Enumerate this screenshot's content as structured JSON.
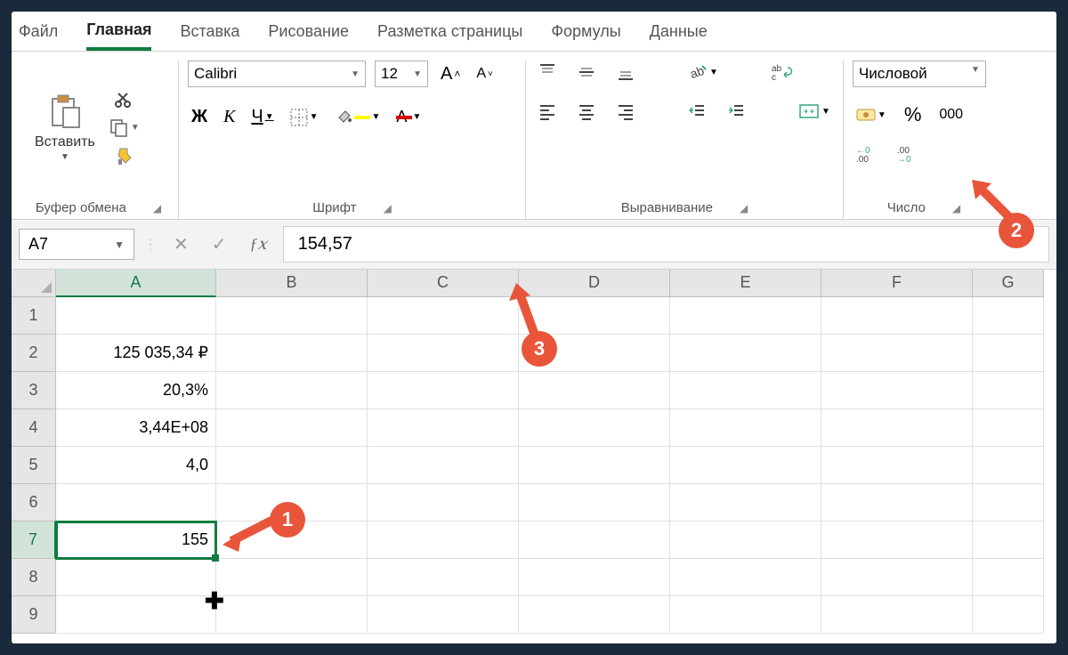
{
  "tabs": {
    "file": "Файл",
    "home": "Главная",
    "insert": "Вставка",
    "draw": "Рисование",
    "layout": "Разметка страницы",
    "formulas": "Формулы",
    "data": "Данные"
  },
  "ribbon": {
    "clipboard": {
      "paste": "Вставить",
      "label": "Буфер обмена"
    },
    "font": {
      "name": "Calibri",
      "size": "12",
      "bold": "Ж",
      "italic": "К",
      "underline": "Ч",
      "label": "Шрифт"
    },
    "alignment": {
      "label": "Выравнивание"
    },
    "number": {
      "format": "Числовой",
      "thousands": "000",
      "label": "Число"
    }
  },
  "formula_bar": {
    "cell_ref": "A7",
    "value": "154,57"
  },
  "columns": [
    "A",
    "B",
    "C",
    "D",
    "E",
    "F",
    "G"
  ],
  "rows": [
    {
      "n": "1",
      "A": ""
    },
    {
      "n": "2",
      "A": "125 035,34 ₽"
    },
    {
      "n": "3",
      "A": "20,3%"
    },
    {
      "n": "4",
      "A": "3,44E+08"
    },
    {
      "n": "5",
      "A": "4,0"
    },
    {
      "n": "6",
      "A": ""
    },
    {
      "n": "7",
      "A": "155"
    },
    {
      "n": "8",
      "A": ""
    },
    {
      "n": "9",
      "A": ""
    }
  ],
  "callouts": {
    "c1": "1",
    "c2": "2",
    "c3": "3"
  }
}
